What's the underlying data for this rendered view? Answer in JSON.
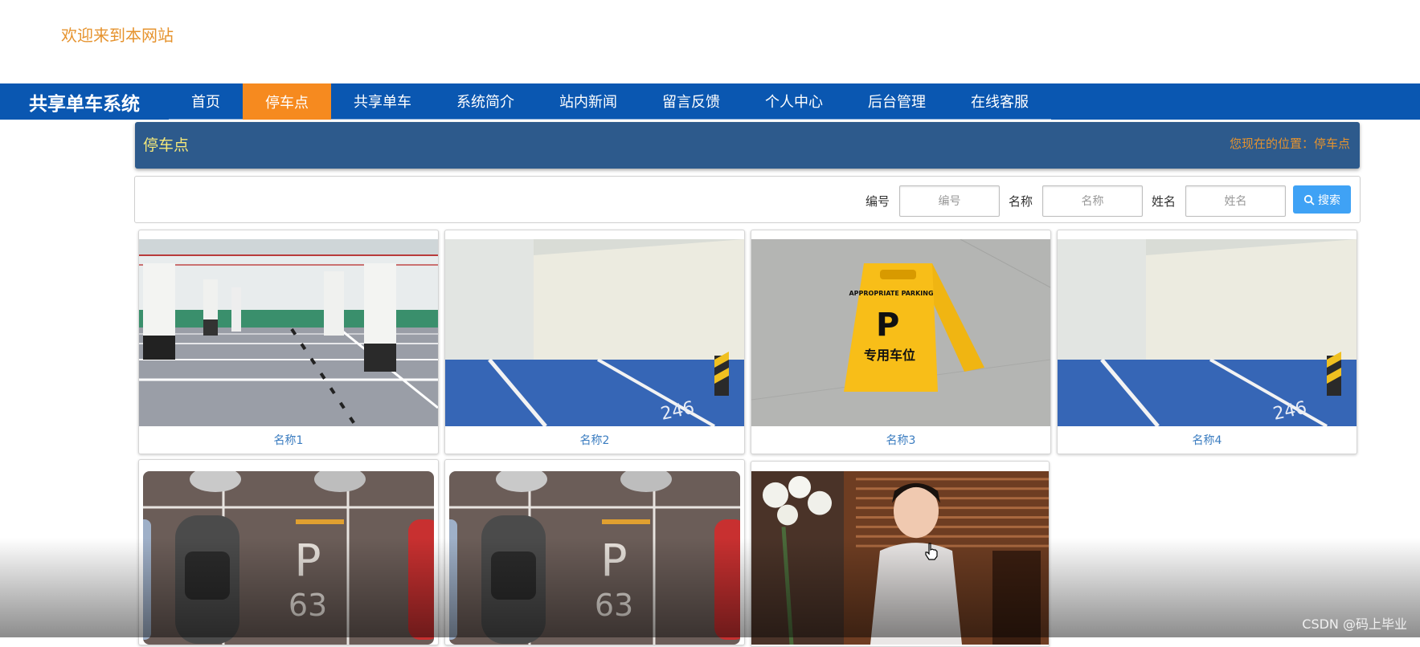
{
  "header": {
    "welcome": "欢迎来到本网站"
  },
  "nav": {
    "brand": "共享单车系统",
    "items": [
      {
        "label": "首页"
      },
      {
        "label": "停车点",
        "active": true
      },
      {
        "label": "共享单车"
      },
      {
        "label": "系统简介"
      },
      {
        "label": "站内新闻"
      },
      {
        "label": "留言反馈"
      },
      {
        "label": "个人中心"
      },
      {
        "label": "后台管理"
      },
      {
        "label": "在线客服"
      }
    ]
  },
  "title_bar": {
    "title": "停车点",
    "breadcrumb": "您现在的位置：停车点"
  },
  "search": {
    "fields": [
      {
        "label": "编号",
        "placeholder": "编号"
      },
      {
        "label": "名称",
        "placeholder": "名称"
      },
      {
        "label": "姓名",
        "placeholder": "姓名"
      }
    ],
    "button_label": "搜索",
    "button_icon": "search-icon"
  },
  "cards": [
    {
      "name": "名称1",
      "image": "underground-garage-photo"
    },
    {
      "name": "名称2",
      "image": "blue-parking-space-photo"
    },
    {
      "name": "名称3",
      "image": "parking-sign-photo"
    },
    {
      "name": "名称4",
      "image": "blue-parking-space-photo"
    },
    {
      "image": "car-parking-p63-photo"
    },
    {
      "image": "car-parking-p63-photo"
    },
    {
      "image": "woman-portrait-photo"
    }
  ],
  "image_text": {
    "sign_top": "APPROPRIATE PARKING",
    "sign_p": "P",
    "sign_cn": "专用车位",
    "floor_number": "246",
    "p_number": "63"
  },
  "watermark": "CSDN @码上毕业",
  "colors": {
    "nav_bg": "#0a57b1",
    "nav_active": "#f68a1f",
    "title_bar_bg": "#2d5a8c",
    "title_text": "#f5e87a",
    "welcome_text": "#e6932e",
    "search_button": "#3fa2f5",
    "card_caption": "#3a7cc0"
  }
}
